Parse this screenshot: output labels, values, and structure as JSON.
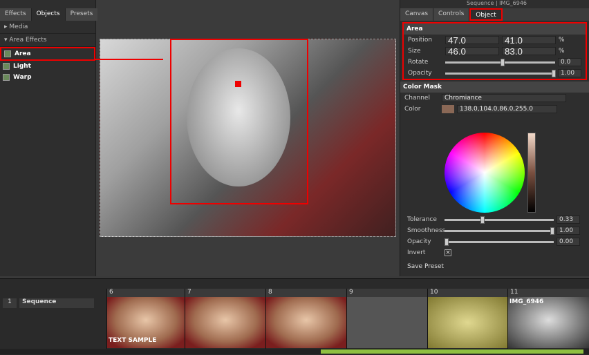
{
  "left_panel": {
    "tabs": [
      "Effects",
      "Objects",
      "Presets"
    ],
    "active_tab": "Objects",
    "media": "Media",
    "area_effects": "Area Effects",
    "items": [
      "Area",
      "Light",
      "Warp"
    ]
  },
  "right_panel": {
    "title": "Sequence | IMG_6946",
    "tabs": [
      "Canvas",
      "Controls",
      "Object"
    ],
    "active_tab": "Object",
    "area": {
      "title": "Area",
      "position": [
        "47.0",
        "41.0"
      ],
      "size": [
        "46.0",
        "83.0"
      ],
      "unit": "%",
      "rotate_label": "Rotate",
      "rotate": "0.0",
      "opacity_label": "Opacity",
      "opacity": "1.00",
      "position_label": "Position",
      "size_label": "Size",
      "rotate_fraction": 0.5,
      "opacity_fraction": 1.0
    },
    "color_mask": {
      "title": "Color Mask",
      "channel_label": "Channel",
      "channel": "Chromiance",
      "color_label": "Color",
      "color": "138.0,104.0,86.0,255.0",
      "swatch": "#8a6856",
      "tolerance_label": "Tolerance",
      "tolerance": "0.33",
      "smoothness_label": "Smoothness",
      "smoothness": "1.00",
      "opacity_label": "Opacity",
      "opacity": "0.00",
      "invert_label": "Invert",
      "save_preset": "Save Preset"
    }
  },
  "timeline": {
    "track_num": "1",
    "track_name": "Sequence",
    "clips": [
      {
        "num": "6",
        "caption": "TEXT SAMPLE"
      },
      {
        "num": "7",
        "caption": ""
      },
      {
        "num": "8",
        "caption": ""
      },
      {
        "num": "9",
        "caption": ""
      },
      {
        "num": "10",
        "caption": ""
      },
      {
        "num": "11",
        "caption": "IMG_6946"
      }
    ]
  },
  "accent": "#e00000"
}
